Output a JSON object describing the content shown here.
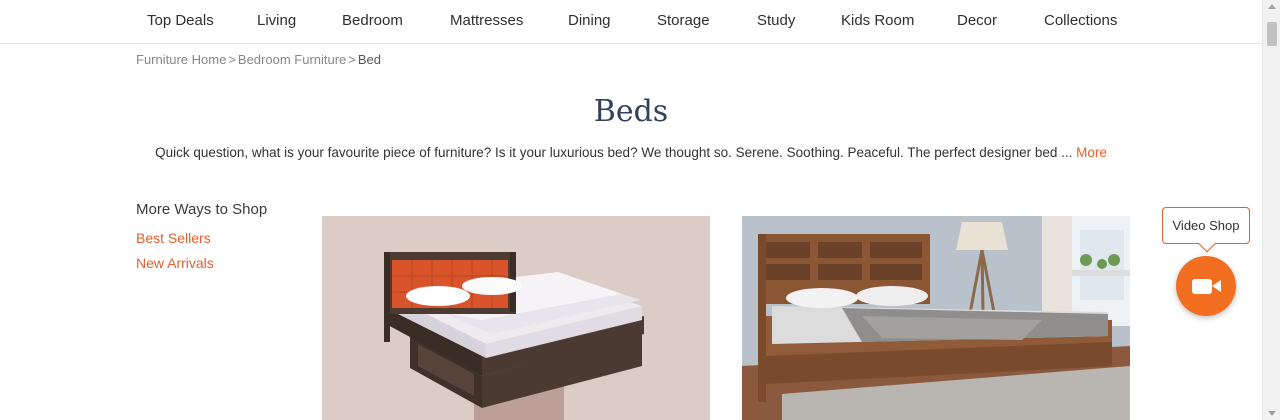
{
  "nav": {
    "items": [
      {
        "label": "Top Deals"
      },
      {
        "label": "Living"
      },
      {
        "label": "Bedroom"
      },
      {
        "label": "Mattresses"
      },
      {
        "label": "Dining"
      },
      {
        "label": "Storage"
      },
      {
        "label": "Study"
      },
      {
        "label": "Kids Room"
      },
      {
        "label": "Decor"
      },
      {
        "label": "Collections"
      }
    ]
  },
  "breadcrumb": {
    "items": [
      "Furniture Home",
      "Bedroom Furniture"
    ],
    "separator": ">",
    "current": "Bed"
  },
  "page": {
    "title": "Beds",
    "description": "Quick question, what is your favourite piece of furniture? Is it your luxurious bed? We thought so. Serene. Soothing. Peaceful. The perfect designer bed ...",
    "more_label": "More"
  },
  "sidebar": {
    "title": "More Ways to Shop",
    "links": [
      {
        "label": "Best Sellers"
      },
      {
        "label": "New Arrivals"
      }
    ]
  },
  "products": [
    {
      "icon": "bed-with-orange-headboard-image"
    },
    {
      "icon": "bed-in-bedroom-image"
    }
  ],
  "video_shop": {
    "label": "Video Shop",
    "icon": "video-camera-icon"
  },
  "colors": {
    "accent": "#e35f2b",
    "video_button": "#f26f21",
    "title": "#33415c"
  }
}
